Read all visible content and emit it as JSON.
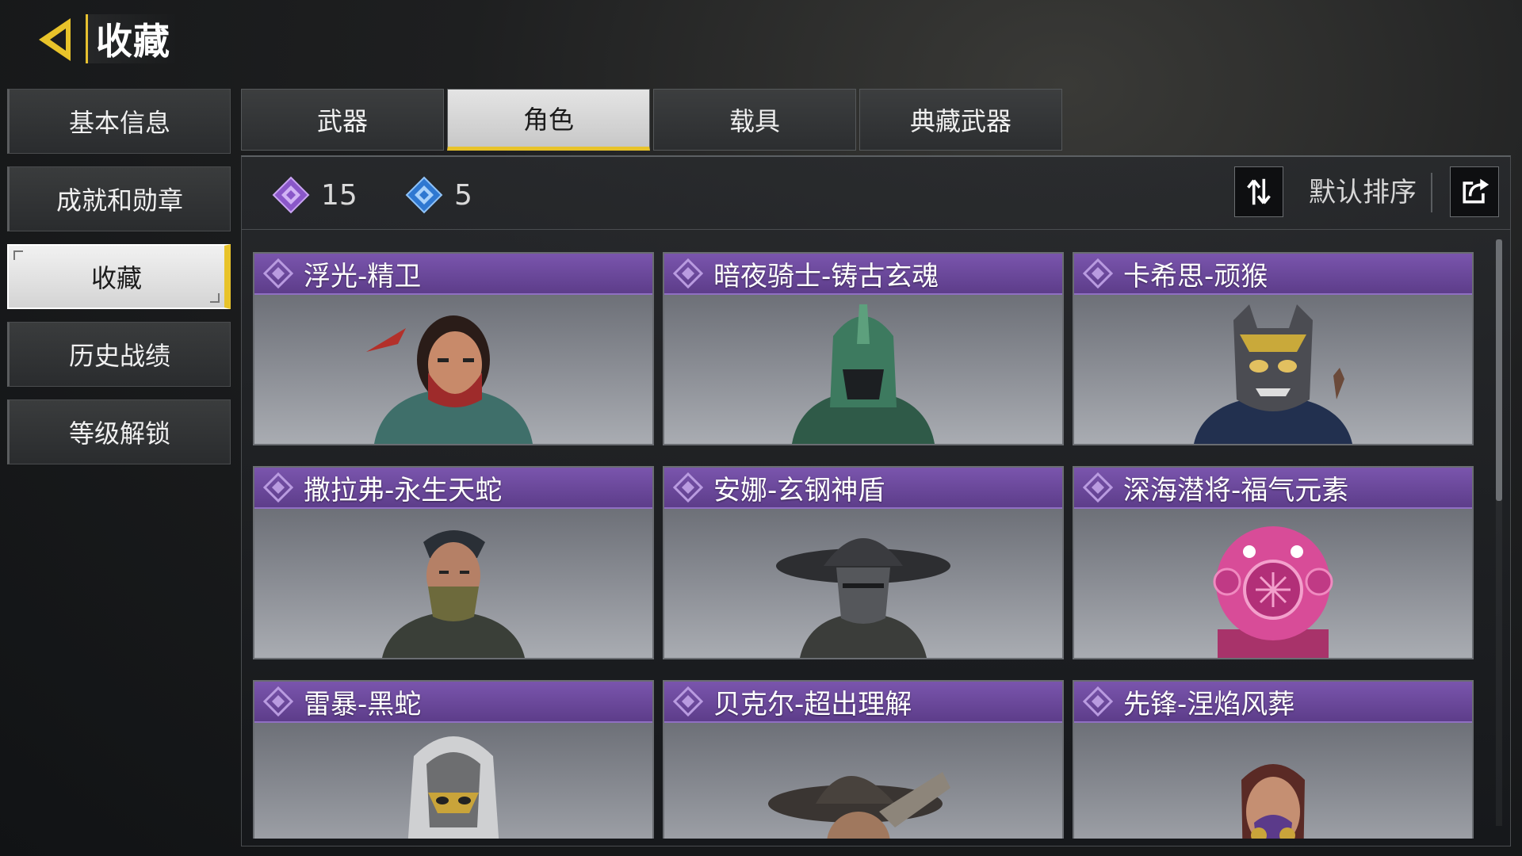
{
  "header": {
    "title": "收藏",
    "back_icon": "back-arrow-icon"
  },
  "sidebar": {
    "items": [
      {
        "label": "基本信息",
        "active": false
      },
      {
        "label": "成就和勋章",
        "active": false
      },
      {
        "label": "收藏",
        "active": true
      },
      {
        "label": "历史战绩",
        "active": false
      },
      {
        "label": "等级解锁",
        "active": false
      }
    ]
  },
  "tabs": [
    {
      "label": "武器",
      "active": false
    },
    {
      "label": "角色",
      "active": true
    },
    {
      "label": "载具",
      "active": false
    },
    {
      "label": "典藏武器",
      "active": false
    }
  ],
  "counts": [
    {
      "icon": "purple-diamond-icon",
      "value": "15",
      "color": "#a86fe0"
    },
    {
      "icon": "blue-diamond-icon",
      "value": "5",
      "color": "#4f9bef"
    }
  ],
  "sort": {
    "label": "默认排序",
    "sort_icon": "sort-arrows-icon",
    "share_icon": "share-icon"
  },
  "colors": {
    "accent": "#e8c32a",
    "rarity_purple": "#6b48a0"
  },
  "cards": [
    {
      "name": "浮光-精卫",
      "portrait": "masked-woman-red-scarf"
    },
    {
      "name": "暗夜骑士-铸古玄魂",
      "portrait": "green-armored-knight"
    },
    {
      "name": "卡希思-顽猴",
      "portrait": "monkey-mask-gold"
    },
    {
      "name": "撒拉弗-永生天蛇",
      "portrait": "masked-soldier-snake"
    },
    {
      "name": "安娜-玄钢神盾",
      "portrait": "wide-hat-helmet"
    },
    {
      "name": "深海潜将-福气元素",
      "portrait": "pink-diving-helmet"
    },
    {
      "name": "雷暴-黑蛇",
      "portrait": "hooded-gold-mask"
    },
    {
      "name": "贝克尔-超出理解",
      "portrait": "cowboy-hat"
    },
    {
      "name": "先锋-涅焰风葬",
      "portrait": "woman-purple-respirator"
    }
  ]
}
